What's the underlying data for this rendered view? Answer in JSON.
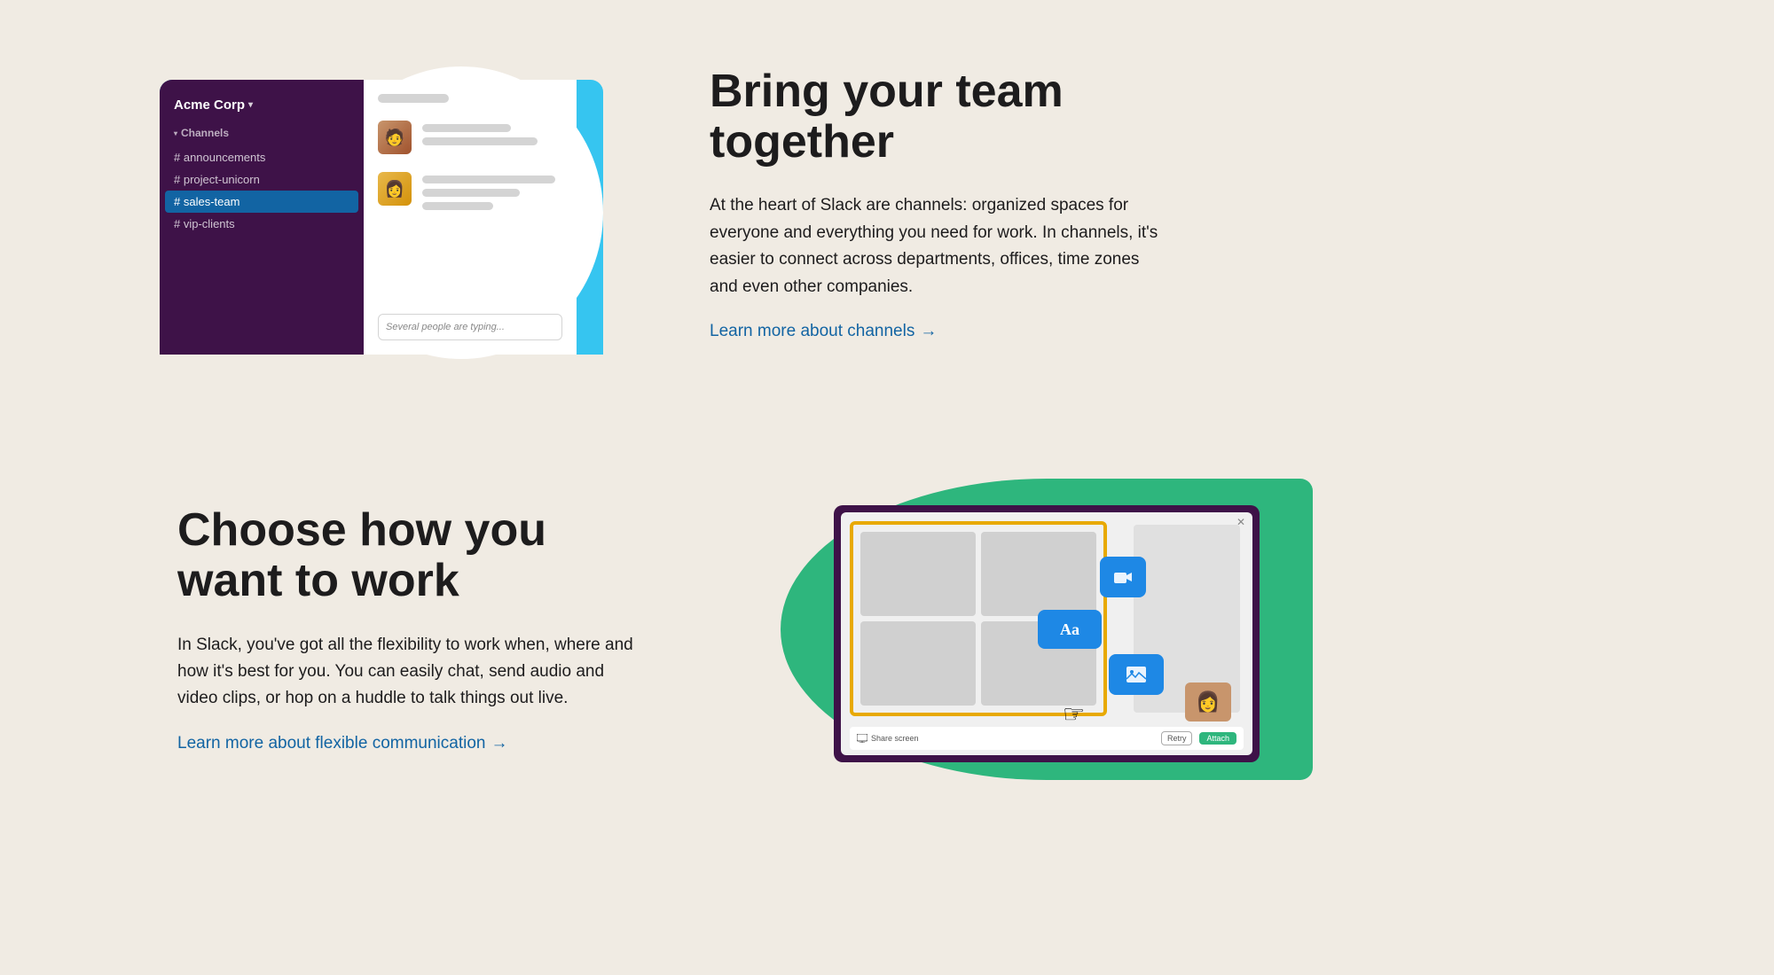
{
  "section1": {
    "workspace": "Acme Corp",
    "channels_label": "Channels",
    "channels": [
      {
        "name": "# announcements",
        "active": false
      },
      {
        "name": "# project-unicorn",
        "active": false
      },
      {
        "name": "# sales-team",
        "active": true
      },
      {
        "name": "# vip-clients",
        "active": false
      }
    ],
    "typing_indicator": "Several people are typing...",
    "heading": "Bring your team together",
    "body": "At the heart of Slack are channels: organized spaces for everyone and everything you need for work. In channels, it's easier to connect across departments, offices, time zones and even other companies.",
    "learn_link": "Learn more about channels",
    "learn_arrow": "→"
  },
  "section2": {
    "heading_line1": "Choose how you",
    "heading_line2": "want to work",
    "body": "In Slack, you've got all the flexibility to work when, where and how it's best for you. You can easily chat, send audio and video clips, or hop on a huddle to talk things out live.",
    "learn_link": "Learn more about flexible communication",
    "learn_arrow": "→",
    "screen": {
      "close_btn": "✕",
      "share_screen_label": "Share screen",
      "retry_label": "Retry",
      "attach_label": "Attach",
      "icon_camera": "⊡",
      "icon_text": "Aa",
      "icon_image": "▤"
    }
  },
  "colors": {
    "teal": "#36c5f0",
    "purple_dark": "#3e1248",
    "green": "#2eb67d",
    "link_blue": "#1264a3",
    "yellow": "#e8a900",
    "bg": "#f0ebe3",
    "text_dark": "#1d1c1d"
  }
}
